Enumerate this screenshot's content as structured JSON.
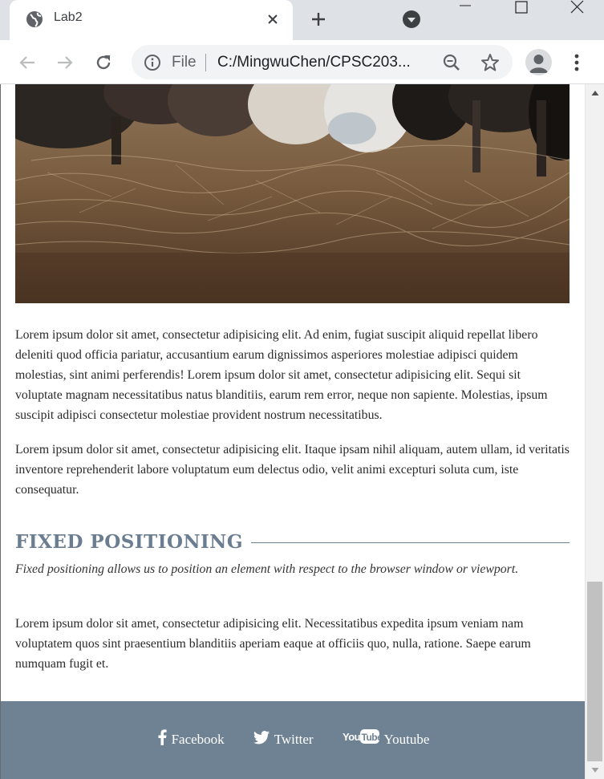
{
  "browser": {
    "tab_title": "Lab2",
    "scheme_label": "File",
    "url": "C:/MingwuChen/CPSC203...",
    "icons": [
      "globe-icon",
      "close-icon",
      "plus-icon",
      "dropdown-icon",
      "minimize-icon",
      "maximize-icon",
      "close-window-icon",
      "back-arrow-icon",
      "forward-arrow-icon",
      "reload-icon",
      "info-icon",
      "zoom-icon",
      "star-icon",
      "profile-icon",
      "menu-icon"
    ]
  },
  "page": {
    "paragraphs": [
      "Lorem ipsum dolor sit amet, consectetur adipisicing elit. Ad enim, fugiat suscipit aliquid repellat libero deleniti quod officia pariatur, accusantium earum dignissimos asperiores molestiae adipisci quidem molestias, sint animi perferendis! Lorem ipsum dolor sit amet, consectetur adipisicing elit. Sequi sit voluptate magnam necessitatibus natus blanditiis, earum rem error, neque non sapiente. Molestias, ipsum suscipit adipisci consectetur molestiae provident nostrum necessitatibus.",
      "Lorem ipsum dolor sit amet, consectetur adipisicing elit. Itaque ipsam nihil aliquam, autem ullam, id veritatis inventore reprehenderit labore voluptatum eum delectus odio, velit animi excepturi soluta cum, iste consequatur."
    ],
    "section": {
      "heading": "FIXED POSITIONING",
      "intro": "Fixed positioning allows us to position an element with respect to the browser window or viewport.",
      "body": "Lorem ipsum dolor sit amet, consectetur adipisicing elit. Necessitatibus expedita ipsum veniam nam voluptatem quos sint praesentium blanditiis aperiam eaque at officiis quo, nulla, ratione. Saepe earum numquam fugit et."
    },
    "footer": {
      "links": [
        {
          "label": "Facebook",
          "icon": "facebook-icon"
        },
        {
          "label": "Twitter",
          "icon": "twitter-icon"
        },
        {
          "label": "Youtube",
          "icon": "youtube-icon"
        }
      ]
    }
  },
  "colors": {
    "accent": "#6f8294",
    "heading": "#6b7d90",
    "footer_bg": "#6f8294",
    "chrome_bg": "#dee1e6"
  }
}
